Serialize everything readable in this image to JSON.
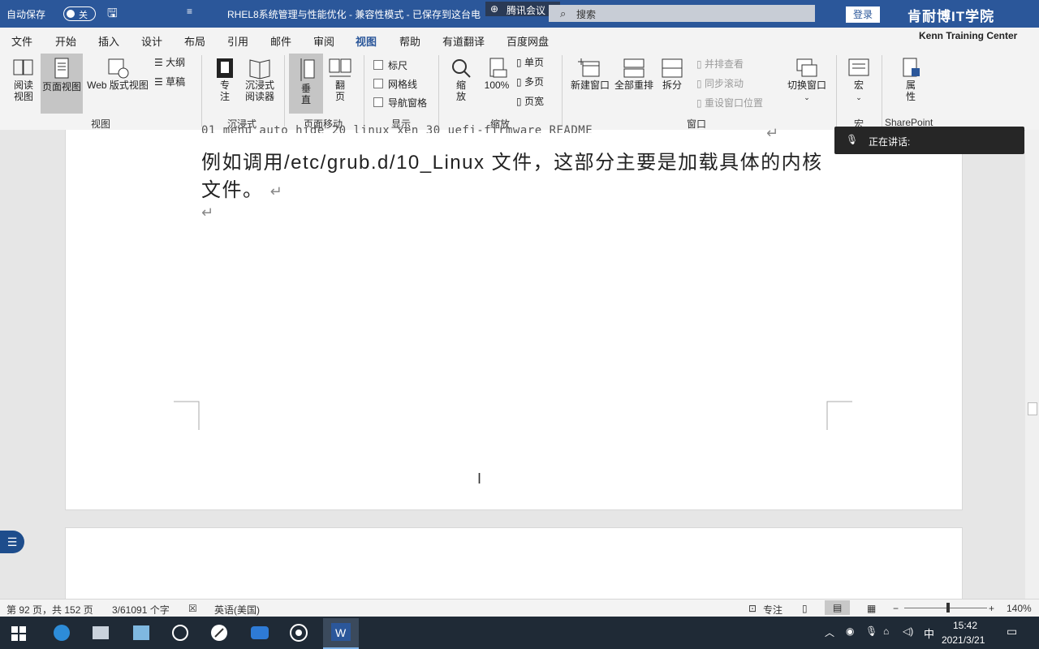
{
  "titlebar": {
    "autosave_label": "自动保存",
    "autosave_state": "关",
    "doc_title": "RHEL8系统管理与性能优化  -  兼容性模式  -  已保存到这台电",
    "search_placeholder": "搜索",
    "login_label": "登录",
    "tencent_meeting": "腾讯会议",
    "watermark_title": "肯耐博IT学院",
    "watermark_sub": "Kenn Training Center"
  },
  "tabs": [
    "文件",
    "开始",
    "插入",
    "设计",
    "布局",
    "引用",
    "邮件",
    "审阅",
    "视图",
    "帮助",
    "有道翻译",
    "百度网盘"
  ],
  "active_tab": "视图",
  "ribbon": {
    "views": {
      "read": "阅读\n视图",
      "page": "页面视图",
      "web": "Web 版式视图",
      "outline": "大纲",
      "draft": "草稿",
      "group": "视图"
    },
    "immersive": {
      "focus": "专\n注",
      "reader": "沉浸式\n阅读器",
      "group": "沉浸式"
    },
    "page_move": {
      "vertical": "垂\n直",
      "flip": "翻\n页",
      "group": "页面移动"
    },
    "show": {
      "ruler": "标尺",
      "grid": "网格线",
      "nav": "导航窗格",
      "group": "显示"
    },
    "zoom": {
      "zoom": "缩\n放",
      "percent": "100%",
      "single": "单页",
      "multi": "多页",
      "width": "页宽",
      "group": "缩放"
    },
    "window": {
      "new": "新建窗口",
      "arrange": "全部重排",
      "split": "拆分",
      "side": "并排查看",
      "sync": "同步滚动",
      "reset": "重设窗口位置",
      "switch": "切换窗口",
      "group": "窗口"
    },
    "macro": {
      "label": "宏",
      "group": "宏"
    },
    "sharepoint": {
      "label": "属\n性",
      "group": "SharePoint"
    }
  },
  "document": {
    "code_line": "01_menu_auto_hide  20_linux_xen  30_uefi-firmware  README",
    "para_pre": "例如调用",
    "para_path": "/etc/grub.d/10_Linux",
    "para_post": " 文件，这部分主要是加载具体的内核",
    "para_line2": "文件。",
    "return_mark": "↵"
  },
  "meeting": {
    "speaking": "正在讲话:"
  },
  "status": {
    "page": "第 92 页，共 152 页",
    "words": "3/61091 个字",
    "lang": "英语(美国)",
    "focus": "专注",
    "zoom": "140%"
  },
  "taskbar": {
    "time": "15:42",
    "date": "2021/3/21",
    "ime": "中"
  }
}
